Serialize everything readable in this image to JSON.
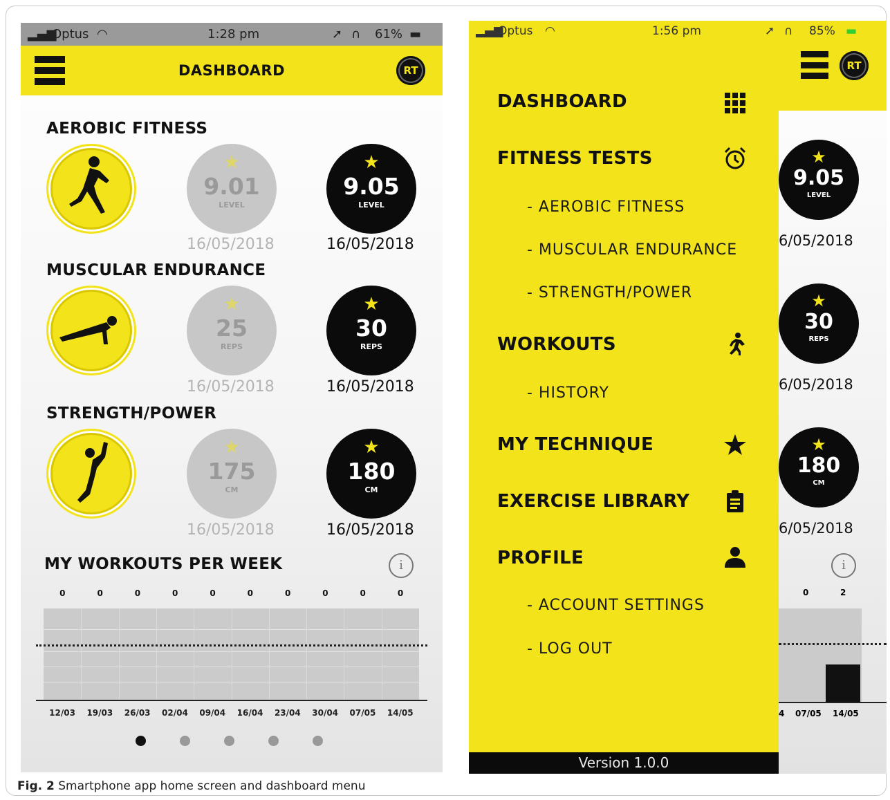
{
  "caption": {
    "label": "Fig. 2",
    "text": "Smartphone app home screen and dashboard menu"
  },
  "dashboard_screen": {
    "status_bar": {
      "carrier": "Optus",
      "time": "1:28 pm",
      "battery": "61%"
    },
    "header": {
      "title": "DASHBOARD",
      "logo": "RT"
    },
    "sections": [
      {
        "title": "AEROBIC FITNESS",
        "icon": "runner-icon",
        "previous": {
          "value": "9.01",
          "unit": "LEVEL",
          "date": "16/05/2018"
        },
        "best": {
          "value": "9.05",
          "unit": "LEVEL",
          "date": "16/05/2018"
        }
      },
      {
        "title": "MUSCULAR ENDURANCE",
        "icon": "pushup-icon",
        "previous": {
          "value": "25",
          "unit": "REPS",
          "date": "16/05/2018"
        },
        "best": {
          "value": "30",
          "unit": "REPS",
          "date": "16/05/2018"
        }
      },
      {
        "title": "STRENGTH/POWER",
        "icon": "jumper-icon",
        "previous": {
          "value": "175",
          "unit": "CM",
          "date": "16/05/2018"
        },
        "best": {
          "value": "180",
          "unit": "CM",
          "date": "16/05/2018"
        }
      }
    ],
    "workouts_title": "MY WORKOUTS PER WEEK",
    "info_glyph": "i",
    "pager": {
      "count": 5,
      "active": 0
    }
  },
  "menu_screen": {
    "status_bar": {
      "carrier": "Optus",
      "time": "1:56 pm",
      "battery": "85%"
    },
    "logo": "RT",
    "menu": [
      {
        "label": "DASHBOARD",
        "icon": "grid-icon"
      },
      {
        "label": "FITNESS TESTS",
        "icon": "alarm-clock-icon"
      },
      {
        "label": "- AEROBIC FITNESS"
      },
      {
        "label": "- MUSCULAR ENDURANCE"
      },
      {
        "label": "- STRENGTH/POWER"
      },
      {
        "label": "WORKOUTS",
        "icon": "running-icon"
      },
      {
        "label": "- HISTORY"
      },
      {
        "label": "MY TECHNIQUE",
        "icon": "star-icon"
      },
      {
        "label": "EXERCISE LIBRARY",
        "icon": "clipboard-icon"
      },
      {
        "label": "PROFILE",
        "icon": "person-icon"
      },
      {
        "label": "- ACCOUNT SETTINGS"
      },
      {
        "label": "- LOG OUT"
      }
    ],
    "version": "Version 1.0.0",
    "peek": {
      "values": [
        {
          "value": "9.05",
          "unit": "LEVEL",
          "date": "6/05/2018"
        },
        {
          "value": "30",
          "unit": "REPS",
          "date": "6/05/2018"
        },
        {
          "value": "180",
          "unit": "CM",
          "date": "6/05/2018"
        }
      ],
      "counts": [
        "0",
        "2"
      ],
      "dates": [
        "4",
        "07/05",
        "14/05"
      ],
      "bar_values": [
        0,
        2
      ]
    }
  },
  "chart_data": {
    "type": "bar",
    "title": "MY WORKOUTS PER WEEK",
    "categories": [
      "12/03",
      "19/03",
      "26/03",
      "02/04",
      "09/04",
      "16/04",
      "23/04",
      "30/04",
      "07/05",
      "14/05"
    ],
    "values": [
      0,
      0,
      0,
      0,
      0,
      0,
      0,
      0,
      0,
      0
    ],
    "value_labels": [
      "0",
      "0",
      "0",
      "0",
      "0",
      "0",
      "0",
      "0",
      "0",
      "0"
    ],
    "ylim": [
      0,
      5
    ],
    "target_line": 3,
    "grid": true
  },
  "colors": {
    "brand_yellow": "#f2e31b",
    "black": "#0b0b0b",
    "previous_gray": "#c7c7c7"
  }
}
